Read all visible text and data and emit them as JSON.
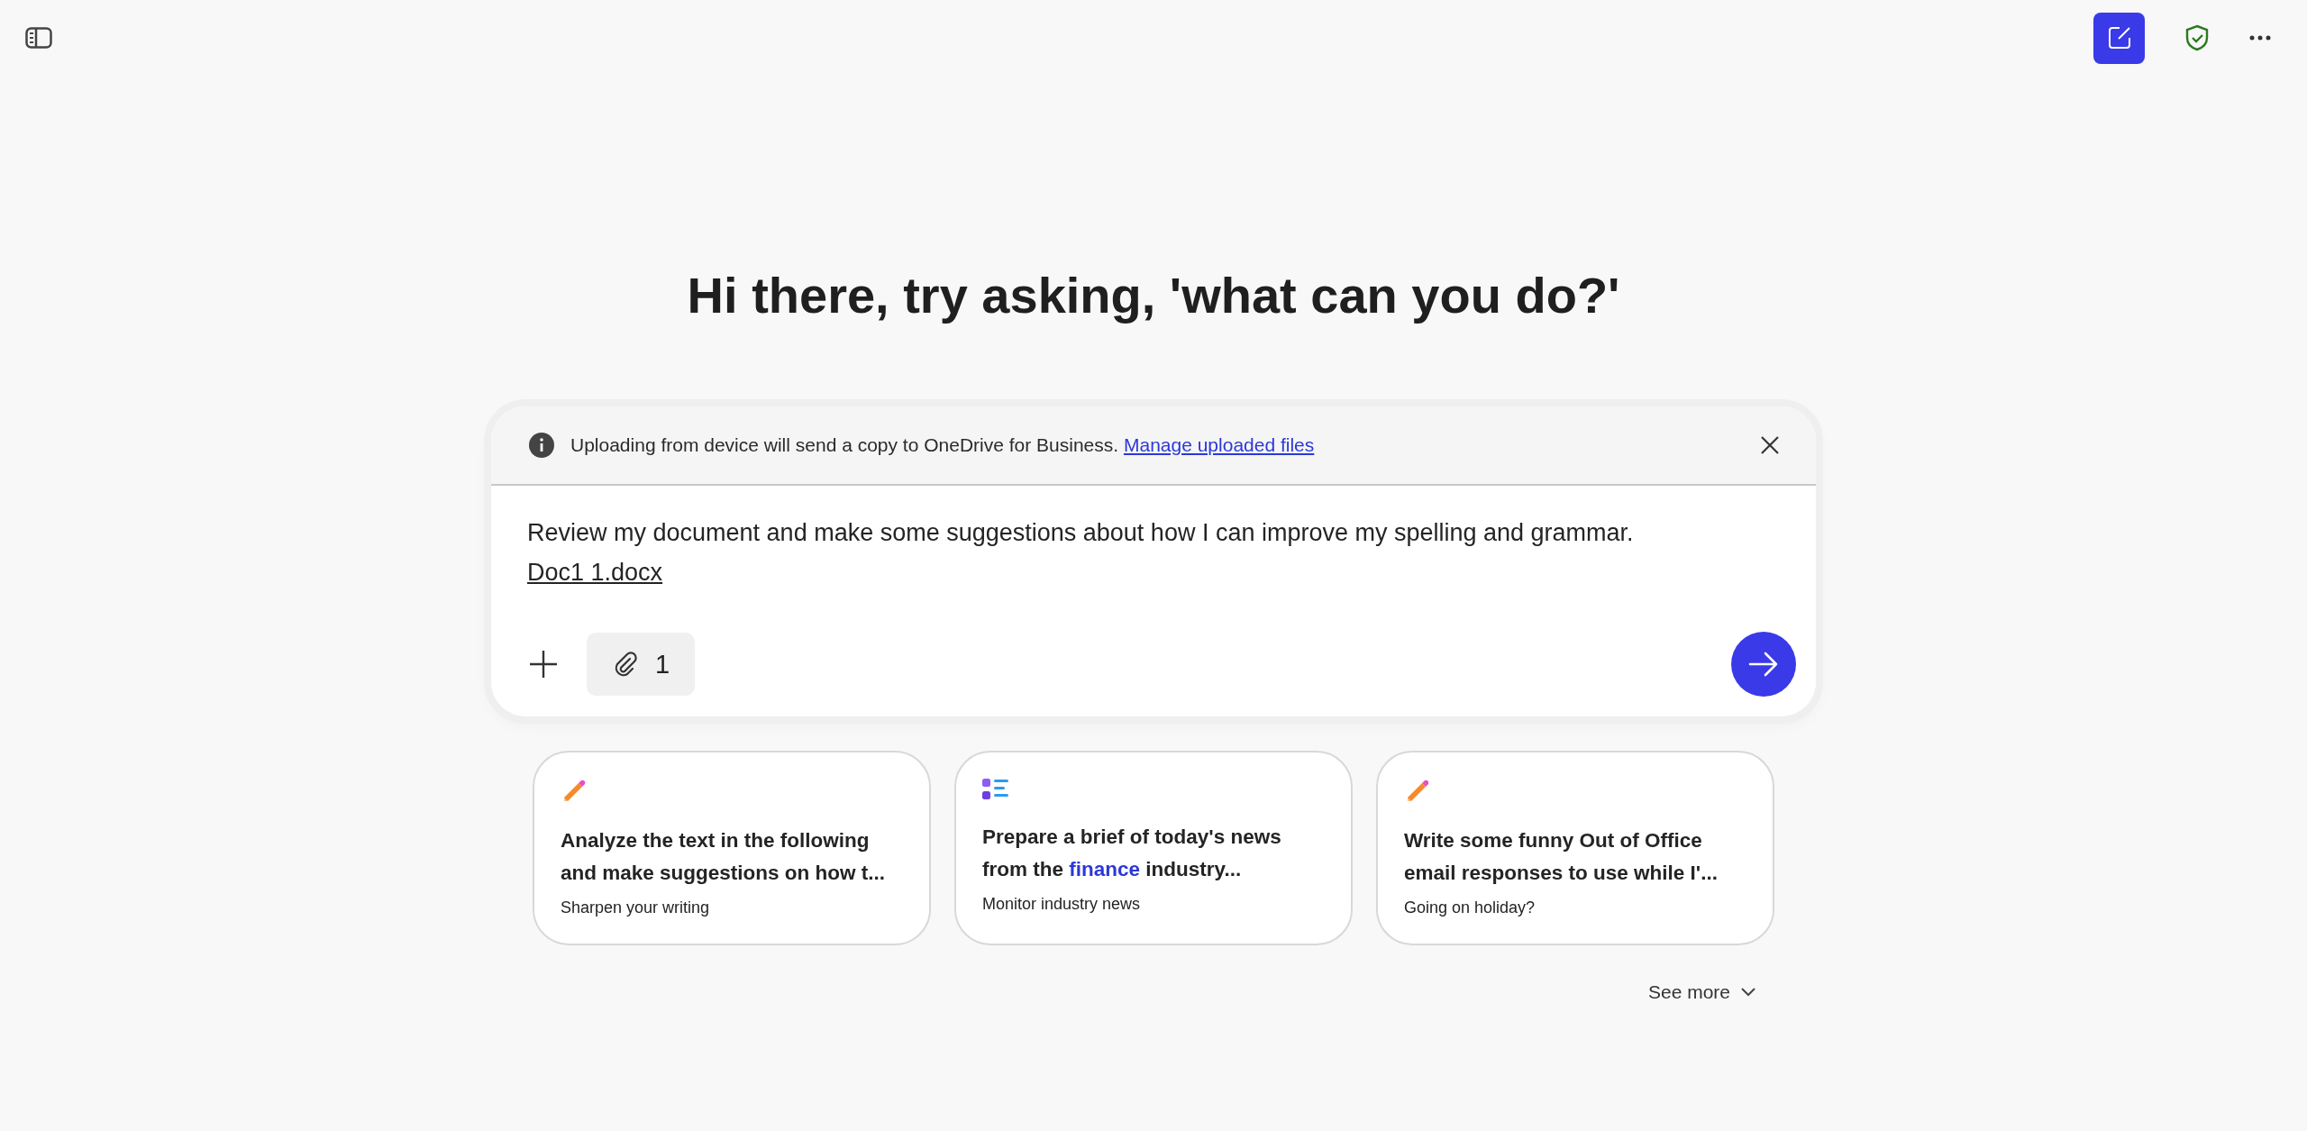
{
  "greeting": "Hi there, try asking, 'what can you do?'",
  "composer": {
    "notice": {
      "text": "Uploading from device will send a copy to OneDrive for Business.",
      "link": "Manage uploaded files"
    },
    "message": "Review my document and make some suggestions about how I can improve my spelling and grammar.",
    "file": "Doc1 1.docx",
    "attachment_count": "1"
  },
  "suggestions": [
    {
      "kind": "pencil",
      "title": [
        {
          "text": "Analyze the text in the following and make suggestions on how t...",
          "highlight": false
        }
      ],
      "subtitle": "Sharpen your writing"
    },
    {
      "kind": "list",
      "title": [
        {
          "text": "Prepare a brief of today's news from the ",
          "highlight": false
        },
        {
          "text": "finance",
          "highlight": true
        },
        {
          "text": " industry...",
          "highlight": false
        }
      ],
      "subtitle": "Monitor industry news"
    },
    {
      "kind": "pencil",
      "title": [
        {
          "text": "Write some funny Out of Office email responses to use while I'...",
          "highlight": false
        }
      ],
      "subtitle": "Going on holiday?"
    }
  ],
  "see_more": "See more"
}
